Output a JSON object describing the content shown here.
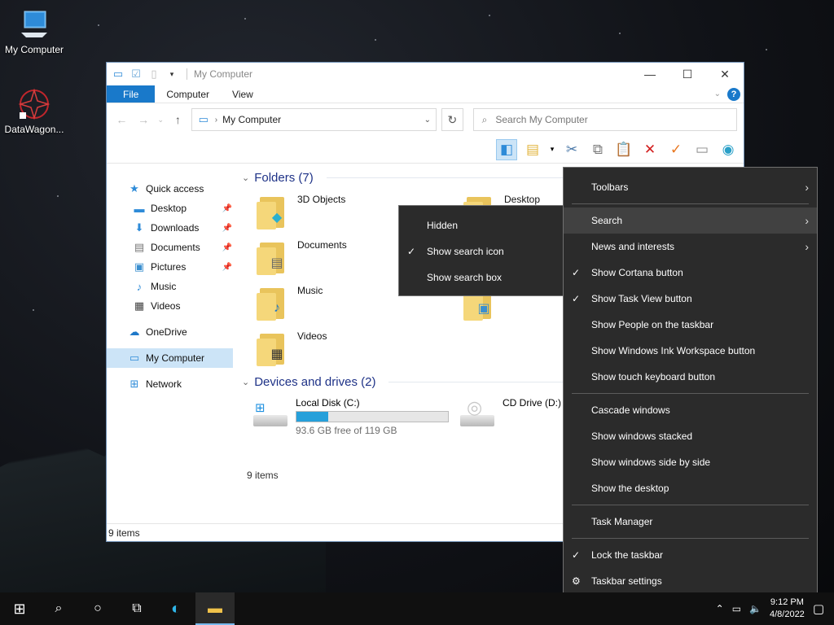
{
  "desktop": {
    "icons": [
      {
        "label": "My Computer"
      },
      {
        "label": "DataWagon..."
      }
    ]
  },
  "window": {
    "title": "My Computer",
    "ribbon_tabs": {
      "file": "File",
      "computer": "Computer",
      "view": "View"
    },
    "address": "My Computer",
    "search_placeholder": "Search My Computer",
    "nav": {
      "quick_access": "Quick access",
      "desktop": "Desktop",
      "downloads": "Downloads",
      "documents": "Documents",
      "pictures": "Pictures",
      "music": "Music",
      "videos": "Videos",
      "onedrive": "OneDrive",
      "my_computer": "My Computer",
      "network": "Network"
    },
    "folders_header": "Folders (7)",
    "folders": {
      "objects3d": "3D Objects",
      "desktop": "Desktop",
      "documents": "Documents",
      "music": "Music",
      "pictures": "Pictures",
      "videos": "Videos"
    },
    "devices_header": "Devices and drives (2)",
    "drives": {
      "c_name": "Local Disk (C:)",
      "c_free": "93.6 GB free of 119 GB",
      "c_used_fraction": 0.21,
      "d_name": "CD Drive (D:)"
    },
    "items_count": "9 items",
    "status_text": "9 items"
  },
  "search_submenu": {
    "hidden": "Hidden",
    "show_icon": "Show search icon",
    "show_box": "Show search box"
  },
  "taskbar_menu": {
    "toolbars": "Toolbars",
    "search": "Search",
    "news": "News and interests",
    "cortana": "Show Cortana button",
    "taskview": "Show Task View button",
    "people": "Show People on the taskbar",
    "ink": "Show Windows Ink Workspace button",
    "touch": "Show touch keyboard button",
    "cascade": "Cascade windows",
    "stacked": "Show windows stacked",
    "side": "Show windows side by side",
    "desktop": "Show the desktop",
    "taskmgr": "Task Manager",
    "lock": "Lock the taskbar",
    "settings": "Taskbar settings"
  },
  "clock": {
    "time": "9:12 PM",
    "date": "4/8/2022"
  },
  "colors": {
    "accent": "#1979ca",
    "selection": "#cce4f7",
    "menu_bg": "#2b2b2b",
    "drive_fill": "#26a0da"
  }
}
